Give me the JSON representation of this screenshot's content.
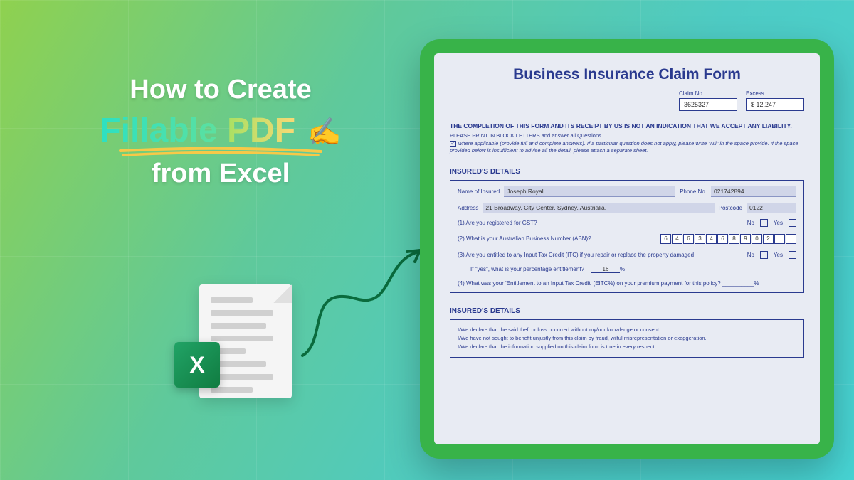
{
  "title": {
    "line1": "How to Create",
    "fillable": "Fillable",
    "pdf": "PDF",
    "emoji": "✍️",
    "line3": "from Excel"
  },
  "excel_letter": "X",
  "form": {
    "title": "Business Insurance Claim Form",
    "claim_no_label": "Claim No.",
    "claim_no": "3625327",
    "excess_label": "Excess",
    "excess": "$ 12,247",
    "instruction_bold": "THE COMPLETION OF THIS FORM AND ITS RECEIPT BY US IS NOT AN INDICATION THAT WE ACCEPT ANY LIABILITY.",
    "instruction_1": "PLEASE PRINT IN BLOCK LETTERS and answer all Questions",
    "instruction_2": "where applicable (provide full and complete answers). If a particular question does not apply, please write \"Nil\" in the space provide. If the space provided below is insufficient to advise all the detail, please attach a separate sheet.",
    "section1": "INSURED'S DETAILS",
    "name_label": "Name of Insured",
    "name": "Joseph Royal",
    "phone_label": "Phone No.",
    "phone": "021742894",
    "address_label": "Address",
    "address": "21 Broadway, City Center, Sydney, Austrialia.",
    "postcode_label": "Postcode",
    "postcode": "0122",
    "q1": "(1) Are you registered for GST?",
    "q2": "(2) What is your Australian Business Number (ABN)?",
    "abn": [
      "6",
      "4",
      "6",
      "3",
      "4",
      "6",
      "8",
      "9",
      "0",
      "2",
      "",
      ""
    ],
    "q3": "(3) Are you entitled to any Input Tax Credit (ITC) if you repair or replace the property damaged",
    "q3b": "If \"yes\", what is your percentage entitlement?",
    "q3_value": "16",
    "q4": "(4) What was your 'Entitlement to an Input Tax Credit' (EITC%) on your premium payment for this policy? __________%",
    "no": "No",
    "yes": "Yes",
    "section2": "INSURED'S DETAILS",
    "decl1": "I/We declare that the said theft or loss occurred without my/our knowledge or consent.",
    "decl2": "I/We have not sought to benefit unjustly from this claim by fraud, wilful misrepresentation or exaggeration.",
    "decl3": "I/We declare that the information supplied on this claim form is true in every respect."
  }
}
